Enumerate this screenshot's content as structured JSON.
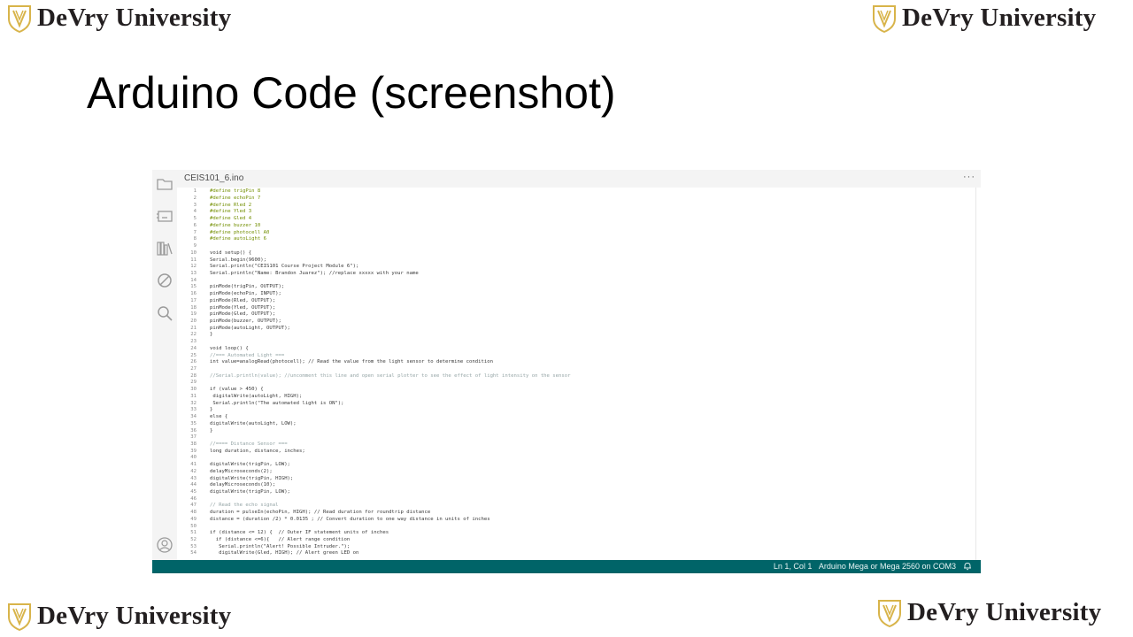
{
  "brand": {
    "name": "DeVry University",
    "shield_color": "#d8b44a"
  },
  "slide": {
    "title": "Arduino Code (screenshot)"
  },
  "ide": {
    "tab_title": "CEIS101_6.ino",
    "more_label": "···",
    "sidebar_icons": [
      "folder-icon",
      "board-manager-icon",
      "library-icon",
      "debug-icon",
      "search-icon",
      "account-icon"
    ],
    "status": {
      "cursor": "Ln 1, Col 1",
      "board": "Arduino Mega or Mega 2560 on COM3"
    },
    "colors": {
      "status_bar": "#006468",
      "sidebar": "#f4f4f4",
      "keyword": "#d35400",
      "preprocessor": "#728e00",
      "type": "#00979d",
      "comment": "#95a5a6"
    },
    "code": [
      {
        "n": "1",
        "t": "#define trigPin 8"
      },
      {
        "n": "2",
        "t": "#define echoPin 7"
      },
      {
        "n": "3",
        "t": "#define Rled 2"
      },
      {
        "n": "4",
        "t": "#define Yled 3"
      },
      {
        "n": "5",
        "t": "#define Gled 4"
      },
      {
        "n": "6",
        "t": "#define buzzer 10"
      },
      {
        "n": "7",
        "t": "#define photocell A0"
      },
      {
        "n": "8",
        "t": "#define autoLight 6"
      },
      {
        "n": "9",
        "t": ""
      },
      {
        "n": "10",
        "t": "void setup() {"
      },
      {
        "n": "11",
        "t": "Serial.begin(9600);"
      },
      {
        "n": "12",
        "t": "Serial.println(\"CEIS101 Course Project Module 6\");"
      },
      {
        "n": "13",
        "t": "Serial.println(\"Name: Brandon Juarez\"); //replace xxxxx with your name"
      },
      {
        "n": "14",
        "t": ""
      },
      {
        "n": "15",
        "t": "pinMode(trigPin, OUTPUT);"
      },
      {
        "n": "16",
        "t": "pinMode(echoPin, INPUT);"
      },
      {
        "n": "17",
        "t": "pinMode(Rled, OUTPUT);"
      },
      {
        "n": "18",
        "t": "pinMode(Yled, OUTPUT);"
      },
      {
        "n": "19",
        "t": "pinMode(Gled, OUTPUT);"
      },
      {
        "n": "20",
        "t": "pinMode(buzzer, OUTPUT);"
      },
      {
        "n": "21",
        "t": "pinMode(autoLight, OUTPUT);"
      },
      {
        "n": "22",
        "t": "}"
      },
      {
        "n": "23",
        "t": ""
      },
      {
        "n": "24",
        "t": "void loop() {"
      },
      {
        "n": "25",
        "t": "//=== Automated Light ==="
      },
      {
        "n": "26",
        "t": "int value=analogRead(photocell); // Read the value from the light sensor to determine condition"
      },
      {
        "n": "27",
        "t": ""
      },
      {
        "n": "28",
        "t": "//Serial.println(value); //uncomment this line and open serial plotter to see the effect of light intensity on the sensor"
      },
      {
        "n": "29",
        "t": ""
      },
      {
        "n": "30",
        "t": "if (value > 450) {"
      },
      {
        "n": "31",
        "t": " digitalWrite(autoLight, HIGH);"
      },
      {
        "n": "32",
        "t": " Serial.println(\"The automated light is ON\");"
      },
      {
        "n": "33",
        "t": "}"
      },
      {
        "n": "34",
        "t": "else {"
      },
      {
        "n": "35",
        "t": "digitalWrite(autoLight, LOW);"
      },
      {
        "n": "36",
        "t": "}"
      },
      {
        "n": "37",
        "t": ""
      },
      {
        "n": "38",
        "t": "//==== Distance Sensor ==="
      },
      {
        "n": "39",
        "t": "long duration, distance, inches;"
      },
      {
        "n": "40",
        "t": ""
      },
      {
        "n": "41",
        "t": "digitalWrite(trigPin, LOW);"
      },
      {
        "n": "42",
        "t": "delayMicroseconds(2);"
      },
      {
        "n": "43",
        "t": "digitalWrite(trigPin, HIGH);"
      },
      {
        "n": "44",
        "t": "delayMicroseconds(10);"
      },
      {
        "n": "45",
        "t": "digitalWrite(trigPin, LOW);"
      },
      {
        "n": "46",
        "t": ""
      },
      {
        "n": "47",
        "t": "// Read the echo signal"
      },
      {
        "n": "48",
        "t": "duration = pulseIn(echoPin, HIGH); // Read duration for roundtrip distance"
      },
      {
        "n": "49",
        "t": "distance = (duration /2) * 0.0135 ; // Convert duration to one way distance in units of inches"
      },
      {
        "n": "50",
        "t": ""
      },
      {
        "n": "51",
        "t": "if (distance <= 12) {  // Outer IF statement units of inches"
      },
      {
        "n": "52",
        "t": "  if (distance <=6){   // Alert range condition"
      },
      {
        "n": "53",
        "t": "   Serial.println(\"Alert! Possible Intruder.\");"
      },
      {
        "n": "54",
        "t": "   digitalWrite(Gled, HIGH); // Alert green LED on"
      }
    ]
  }
}
